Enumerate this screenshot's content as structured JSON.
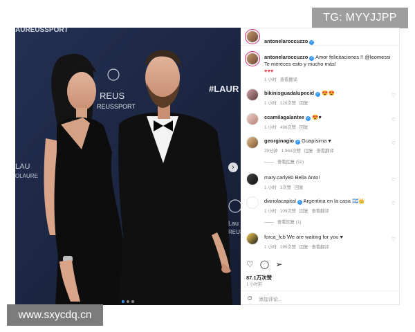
{
  "watermark_top": "TG: MYYJJPP",
  "watermark_bottom": "www.sxycdq.cn",
  "photo": {
    "backdrop_text_top": "AUREUSSPORT",
    "backdrop_text_left1": "LAU",
    "backdrop_text_left2": "OLAURE",
    "backdrop_text_mid": "REUS",
    "backdrop_text_mid2": "REUSSPORT",
    "backdrop_text_right": "#LAUR",
    "backdrop_text_right2": "Lau",
    "backdrop_text_right3": "REUS"
  },
  "post": {
    "author": "antonelaroccuzzo",
    "caption_author": "antonelaroccuzzo",
    "caption_text": "Amor felicitaciones !! @leomessi",
    "caption_text2": "Te mereces esto y mucho más!",
    "caption_hearts": "♥♥♥",
    "caption_time": "1 小时",
    "caption_translate": "查看翻译",
    "likes": "87.1万次赞",
    "posted_ago": "1 小时前",
    "add_comment_placeholder": "添加评论...",
    "comments": [
      {
        "user": "bikinisguadalupecid",
        "text": "😍😍",
        "time": "1 小时",
        "likes": "120次赞",
        "reply": "回复",
        "verified": true
      },
      {
        "user": "ccamilagalantee",
        "text": "😍♥",
        "time": "1 小时",
        "likes": "496次赞",
        "reply": "回复",
        "verified": true
      },
      {
        "user": "georginagio",
        "text": "Guapísima ♥",
        "time": "39分钟",
        "likes": "1,963次赞",
        "reply": "回复",
        "translate": "查看翻译",
        "verified": true,
        "view_replies": "查看回复 (52)"
      },
      {
        "user": "mary.carly80",
        "text": "Bella Anto!",
        "time": "1 小时",
        "likes": "3次赞",
        "reply": "回复",
        "verified": false
      },
      {
        "user": "diariolacapital",
        "text": "Argentina en la casa 🇦🇷👑",
        "time": "1 小时",
        "likes": "109次赞",
        "reply": "回复",
        "translate": "查看翻译",
        "verified": true,
        "view_replies": "查看回复 (1)"
      },
      {
        "user": "forca_fcb",
        "text": "We are waiting for you ♥",
        "time": "1 小时",
        "likes": "195次赞",
        "reply": "回复",
        "translate": "查看翻译",
        "verified": false
      }
    ]
  },
  "colors": {
    "verified": "#3897f0",
    "heart": "#ed4956",
    "backdrop": "#1f2a44"
  },
  "icons": [
    "heart-icon",
    "comment-icon",
    "share-icon",
    "smile-icon",
    "chevron-right-icon"
  ]
}
